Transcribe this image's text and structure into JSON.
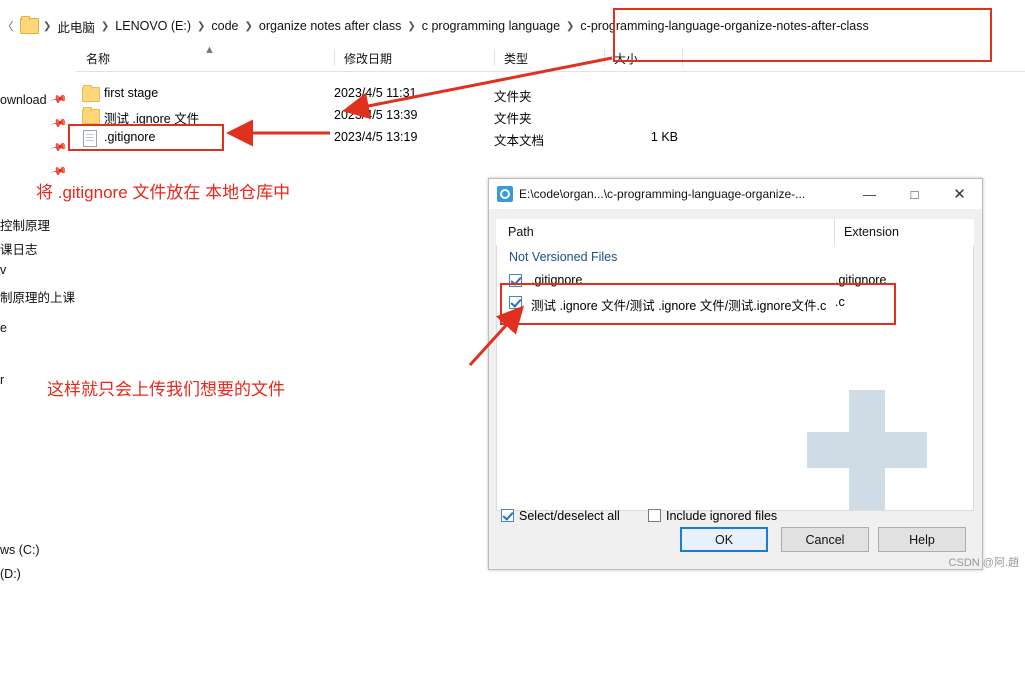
{
  "explorer": {
    "breadcrumbs": [
      "此电脑",
      "LENOVO (E:)",
      "code",
      "organize notes after class",
      "c programming language",
      "c-programming-language-organize-notes-after-class"
    ],
    "columns": {
      "name": "名称",
      "date": "修改日期",
      "type": "类型",
      "size": "大小"
    },
    "files": [
      {
        "icon": "folder-icon",
        "name": "first stage",
        "date": "2023/4/5 11:31",
        "type": "文件夹",
        "size": ""
      },
      {
        "icon": "folder-icon",
        "name": "测试 .ignore 文件",
        "date": "2023/4/5 13:39",
        "type": "文件夹",
        "size": ""
      },
      {
        "icon": "document-icon",
        "name": ".gitignore",
        "date": "2023/4/5 13:19",
        "type": "文本文档",
        "size": "1 KB"
      }
    ],
    "sidebar_items": [
      "ownload",
      "控制原理",
      "课日志",
      "v",
      "制原理的上课",
      "e",
      "r",
      "ws (C:)",
      "(D:)"
    ]
  },
  "annotations": {
    "note1": "将 .gitignore 文件放在 本地仓库中",
    "note2": "这样就只会上传我们想要的文件",
    "color": "#e8271a"
  },
  "dialog": {
    "title": "E:\\code\\organ...\\c-programming-language-organize-...",
    "titlebar_buttons": {
      "minimize": "—",
      "maximize": "□",
      "close": "✕"
    },
    "columns": {
      "path": "Path",
      "extension": "Extension"
    },
    "group_label": "Not Versioned Files",
    "rows": [
      {
        "checked": true,
        "path": ".gitignore",
        "extension": ".gitignore"
      },
      {
        "checked": true,
        "path": "测试 .ignore 文件/测试 .ignore 文件/测试.ignore文件.c",
        "extension": ".c"
      }
    ],
    "options": [
      {
        "label": "Select/deselect all",
        "checked": true
      },
      {
        "label": "Include ignored files",
        "checked": false
      }
    ],
    "buttons": {
      "ok": "OK",
      "cancel": "Cancel",
      "help": "Help"
    }
  },
  "watermark": "CSDN @阿.趙"
}
